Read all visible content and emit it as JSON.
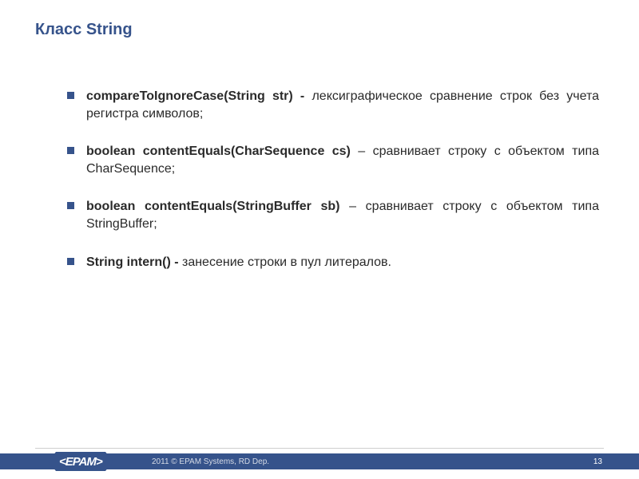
{
  "title": "Класс String",
  "items": [
    {
      "bold": "compareToIgnoreCase(String str) - ",
      "rest": "лексиграфическое сравнение строк без учета регистра символов;"
    },
    {
      "bold": "boolean contentEquals(CharSequence cs)",
      "rest": " – сравнивает строку с объектом типа CharSequence;"
    },
    {
      "bold": "boolean contentEquals(StringBuffer sb)",
      "rest": " – сравнивает строку с объектом типа StringBuffer;"
    },
    {
      "bold": "String intern() - ",
      "rest": "занесение строки в пул литералов."
    }
  ],
  "footer": {
    "logo": "<EPAM>",
    "copyright": "2011 © EPAM Systems, RD Dep.",
    "page": "13"
  }
}
